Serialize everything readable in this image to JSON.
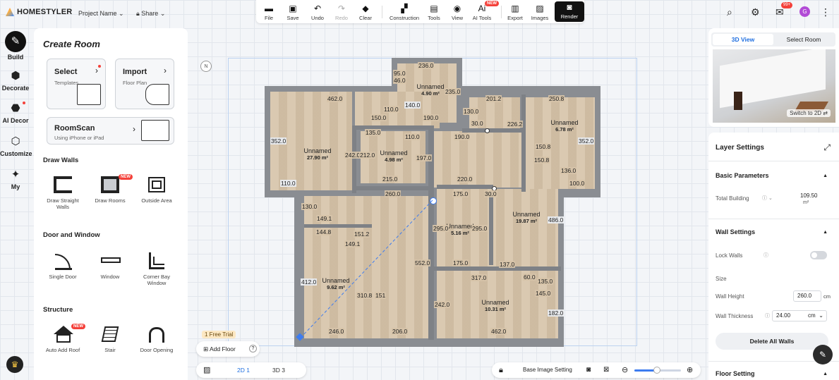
{
  "app": {
    "name": "HOMESTYLER",
    "project_label": "Project Name",
    "share_label": "Share"
  },
  "toolbar": {
    "file": "File",
    "save": "Save",
    "undo": "Undo",
    "redo": "Redo",
    "clear": "Clear",
    "construction": "Construction",
    "tools": "Tools",
    "view": "View",
    "ai_tools": "AI Tools",
    "ai_badge": "NEW",
    "export": "Export",
    "images": "Images",
    "render": "Render"
  },
  "header_right": {
    "notification_count": "99+",
    "avatar_letter": "G"
  },
  "leftnav": {
    "build": "Build",
    "decorate": "Decorate",
    "ai_decor": "AI Decor",
    "customize": "Customize",
    "my": "My"
  },
  "panel": {
    "title": "Create Room",
    "select": {
      "title": "Select",
      "sub": "Templates"
    },
    "import": {
      "title": "Import",
      "sub": "Floor Plan"
    },
    "roomscan": {
      "title": "RoomScan",
      "sub": "Using iPhone or iPad"
    },
    "draw_walls": {
      "heading": "Draw Walls",
      "straight": "Draw Straight Walls",
      "rooms": "Draw Rooms",
      "rooms_badge": "NEW",
      "outside": "Outside Area"
    },
    "door_window": {
      "heading": "Door and Window",
      "single_door": "Single Door",
      "window": "Window",
      "corner_bay": "Corner Bay Window"
    },
    "structure": {
      "heading": "Structure",
      "auto_roof": "Auto Add Roof",
      "roof_badge": "NEW",
      "stair": "Stair",
      "door_opening": "Door Opening"
    }
  },
  "plan": {
    "rooms": [
      {
        "name": "Unnamed",
        "area": "4.90 m²"
      },
      {
        "name": "Unnamed",
        "area": "6.78 m²"
      },
      {
        "name": "Unnamed",
        "area": "27.90 m²"
      },
      {
        "name": "Unnamed",
        "area": "4.98 m²"
      },
      {
        "name": "Unnamed",
        "area": "19.87 m²"
      },
      {
        "name": "Unnamed",
        "area": "5.16 m²"
      },
      {
        "name": "Unnamed",
        "area": "9.62 m²"
      },
      {
        "name": "Unnamed",
        "area": "10.31 m²"
      }
    ],
    "dims": {
      "d236": "236.0",
      "d95": "95.0",
      "d46": "46.0",
      "d235": "235.0",
      "d462a": "462.0",
      "d140": "140.0",
      "d201": "201.2",
      "d250": "250.8",
      "d110a": "110.0",
      "d150a": "150.0",
      "d190a": "190.0",
      "d130a": "130.0",
      "d30a": "30.0",
      "d226": "226.2",
      "d352a": "352.0",
      "d135": "135.0",
      "d110b": "110.0",
      "d190b": "190.0",
      "d352b": "352.0",
      "d242": "242.0",
      "d212": "212.0",
      "d197": "197.0",
      "d1508": "150.8",
      "d1508b": "150.8",
      "d136": "136.0",
      "d215": "215.0",
      "d220": "220.0",
      "d110c": "110.0",
      "d100": "100.0",
      "d260": "260.0",
      "d175a": "175.0",
      "d30b": "30.0",
      "d130b": "130.0",
      "d149a": "149.1",
      "d486": "486.0",
      "d144": "144.8",
      "d151": "151.2",
      "d295a": "295.0",
      "d295b": "295.0",
      "d149b": "149.1",
      "d552": "552.0",
      "d175b": "175.0",
      "d137": "137.0",
      "d412": "412.0",
      "d317": "317.0",
      "d60": "60.0",
      "d1350": "135.0",
      "d310": "310.8",
      "d151b": "151",
      "d145": "145.0",
      "d242b": "242.0",
      "d182": "182.0",
      "d246": "246.0",
      "d206": "206.0",
      "d462b": "462.0"
    }
  },
  "canvas": {
    "trial": "1 Free Trial",
    "add_floor": "Add Floor",
    "view2d": "2D",
    "view2d_num": "1",
    "view3d": "3D",
    "view3d_num": "3",
    "base_image": "Base Image Setting",
    "zoom_level": 0.48
  },
  "right": {
    "tab_3d": "3D View",
    "tab_select": "Select Room",
    "switch": "Switch to 2D",
    "layer_settings": "Layer Settings",
    "basic_params": "Basic Parameters",
    "total_building": "Total Building",
    "total_value": "109.50",
    "total_unit": "m²",
    "wall_settings": "Wall Settings",
    "lock_walls": "Lock Walls",
    "size": "Size",
    "wall_height": "Wall Height",
    "wall_height_val": "260.0",
    "cm": "cm",
    "wall_thickness": "Wall Thickness",
    "wall_thickness_val": "24.00",
    "delete_all": "Delete All Walls",
    "floor_setting": "Floor Setting"
  }
}
